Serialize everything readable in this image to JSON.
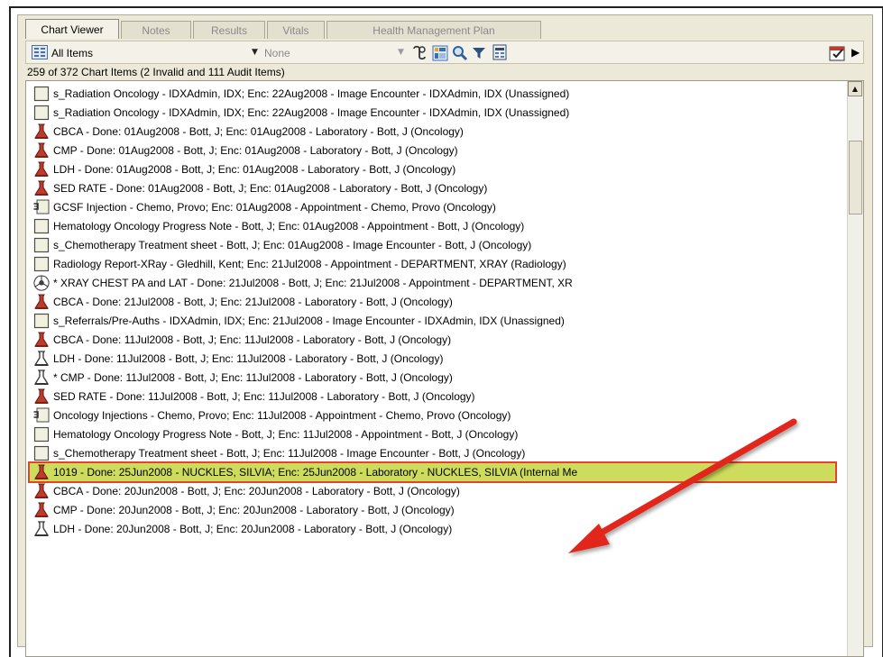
{
  "tabs": [
    {
      "label": "Chart Viewer",
      "active": true
    },
    {
      "label": "Notes",
      "active": false
    },
    {
      "label": "Results",
      "active": false
    },
    {
      "label": "Vitals",
      "active": false
    },
    {
      "label": "Health Management Plan",
      "active": false
    }
  ],
  "toolbar": {
    "view_filter": "All Items",
    "secondary_filter": "None",
    "icons": [
      "list-view-icon",
      "dropdown-arrow-icon",
      "scroll-icon",
      "grid-icon",
      "search-icon",
      "filter-icon",
      "print-icon",
      "calendar-icon",
      "expand-right-icon"
    ]
  },
  "summary": "259 of 372 Chart Items (2 Invalid and 111 Audit Items)",
  "items": [
    {
      "icon": "document-icon",
      "text": "s_Radiation Oncology - IDXAdmin, IDX; Enc: 22Aug2008 - Image Encounter - IDXAdmin, IDX (Unassigned)"
    },
    {
      "icon": "document-icon",
      "text": "s_Radiation Oncology - IDXAdmin, IDX; Enc: 22Aug2008 - Image Encounter - IDXAdmin, IDX (Unassigned)"
    },
    {
      "icon": "lab-flask-red-icon",
      "text": "CBCA - Done: 01Aug2008 - Bott, J; Enc: 01Aug2008 - Laboratory - Bott, J (Oncology)"
    },
    {
      "icon": "lab-flask-red-icon",
      "text": "CMP - Done: 01Aug2008 - Bott, J; Enc: 01Aug2008 - Laboratory - Bott, J (Oncology)"
    },
    {
      "icon": "lab-flask-red-icon",
      "text": "LDH - Done: 01Aug2008 - Bott, J; Enc: 01Aug2008 - Laboratory - Bott, J (Oncology)"
    },
    {
      "icon": "lab-flask-red-icon",
      "text": "SED RATE - Done: 01Aug2008 - Bott, J; Enc: 01Aug2008 - Laboratory - Bott, J (Oncology)"
    },
    {
      "icon": "injection-icon",
      "text": "GCSF Injection - Chemo, Provo; Enc: 01Aug2008 - Appointment - Chemo, Provo (Oncology)"
    },
    {
      "icon": "document-icon",
      "text": "Hematology Oncology Progress Note - Bott, J; Enc: 01Aug2008 - Appointment - Bott, J (Oncology)"
    },
    {
      "icon": "document-icon",
      "text": "s_Chemotherapy Treatment sheet - Bott, J; Enc: 01Aug2008 - Image Encounter - Bott, J (Oncology)"
    },
    {
      "icon": "document-icon",
      "text": "Radiology Report-XRay - Gledhill, Kent; Enc: 21Jul2008 - Appointment - DEPARTMENT, XRAY (Radiology)"
    },
    {
      "icon": "radiation-icon",
      "text": "* XRAY CHEST PA and LAT - Done: 21Jul2008 - Bott, J; Enc: 21Jul2008 - Appointment - DEPARTMENT, XR"
    },
    {
      "icon": "lab-flask-red-icon",
      "text": "CBCA - Done: 21Jul2008 - Bott, J; Enc: 21Jul2008 - Laboratory - Bott, J (Oncology)"
    },
    {
      "icon": "document-icon",
      "text": "s_Referrals/Pre-Auths - IDXAdmin, IDX; Enc: 21Jul2008 - Image Encounter - IDXAdmin, IDX (Unassigned)"
    },
    {
      "icon": "lab-flask-red-icon",
      "text": "CBCA - Done: 11Jul2008 - Bott, J; Enc: 11Jul2008 - Laboratory - Bott, J (Oncology)"
    },
    {
      "icon": "lab-flask-outline-icon",
      "text": "LDH - Done: 11Jul2008 - Bott, J; Enc: 11Jul2008 - Laboratory - Bott, J (Oncology)"
    },
    {
      "icon": "lab-flask-outline-icon",
      "text": "* CMP - Done: 11Jul2008 - Bott, J; Enc: 11Jul2008 - Laboratory - Bott, J (Oncology)"
    },
    {
      "icon": "lab-flask-red-icon",
      "text": "SED RATE - Done: 11Jul2008 - Bott, J; Enc: 11Jul2008 - Laboratory - Bott, J (Oncology)"
    },
    {
      "icon": "injection-icon",
      "text": "Oncology Injections - Chemo, Provo; Enc: 11Jul2008 - Appointment - Chemo, Provo (Oncology)"
    },
    {
      "icon": "document-icon",
      "text": "Hematology Oncology Progress Note - Bott, J; Enc: 11Jul2008 - Appointment - Bott, J (Oncology)"
    },
    {
      "icon": "document-icon",
      "text": "s_Chemotherapy Treatment sheet - Bott, J; Enc: 11Jul2008 - Image Encounter - Bott, J (Oncology)"
    },
    {
      "icon": "lab-flask-red-icon",
      "text": "1019 - Done: 25Jun2008 - NUCKLES, SILVIA; Enc: 25Jun2008 - Laboratory - NUCKLES, SILVIA (Internal Me",
      "highlighted": true
    },
    {
      "icon": "lab-flask-red-icon",
      "text": "CBCA - Done: 20Jun2008 - Bott, J; Enc: 20Jun2008 - Laboratory - Bott, J (Oncology)"
    },
    {
      "icon": "lab-flask-red-icon",
      "text": "CMP - Done: 20Jun2008 - Bott, J; Enc: 20Jun2008 - Laboratory - Bott, J (Oncology)"
    },
    {
      "icon": "lab-flask-outline-icon",
      "text": "LDH - Done: 20Jun2008 - Bott, J; Enc: 20Jun2008 - Laboratory - Bott, J (Oncology)"
    }
  ],
  "colors": {
    "highlight_fill": "#cddc5c",
    "highlight_border": "#e8412b",
    "annotation_arrow": "#e3261b",
    "lab_icon_red": "#c0392b",
    "window_bg": "#ece9d8"
  }
}
